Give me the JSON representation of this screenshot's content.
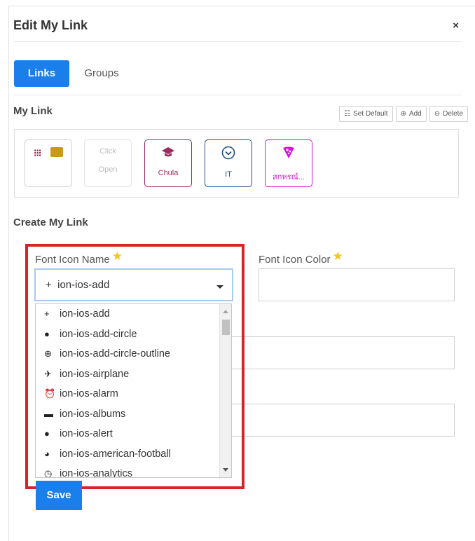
{
  "modal": {
    "title": "Edit My Link",
    "close": "×"
  },
  "tabs": [
    {
      "label": "Links"
    },
    {
      "label": "Groups"
    }
  ],
  "my_link": {
    "title": "My Link",
    "toolbar": {
      "set_default": "Set Default",
      "add": "Add",
      "delete": "Delete"
    },
    "tiles": [
      {
        "icon": "grid-folder-icon"
      },
      {
        "line1": "Click",
        "line2": "Open"
      },
      {
        "icon": "graduation-cap-icon",
        "label": "Chula",
        "color": "#9c2a5a"
      },
      {
        "icon": "chevron-circle-icon",
        "label": "IT",
        "color": "#1f4f86"
      },
      {
        "icon": "pizza-icon",
        "label": "สกหรณ์...",
        "color": "#d514d5"
      }
    ]
  },
  "create": {
    "title": "Create My Link",
    "font_icon_name_label": "Font Icon Name",
    "font_icon_color_label": "Font Icon Color",
    "required_mark": "★",
    "selected_icon": "ion-ios-add",
    "save_label": "Save"
  },
  "dropdown": {
    "items": [
      {
        "glyph": "+",
        "name": "ion-ios-add"
      },
      {
        "glyph": "●",
        "name": "ion-ios-add-circle"
      },
      {
        "glyph": "⊕",
        "name": "ion-ios-add-circle-outline"
      },
      {
        "glyph": "✈",
        "name": "ion-ios-airplane"
      },
      {
        "glyph": "⏰",
        "name": "ion-ios-alarm"
      },
      {
        "glyph": "▬",
        "name": "ion-ios-albums"
      },
      {
        "glyph": "●",
        "name": "ion-ios-alert"
      },
      {
        "glyph": "◕",
        "name": "ion-ios-american-football"
      },
      {
        "glyph": "◷",
        "name": "ion-ios-analytics"
      }
    ]
  },
  "colors": {
    "primary": "#1a7fea",
    "highlight": "#d4242a",
    "star": "#f5c518"
  }
}
